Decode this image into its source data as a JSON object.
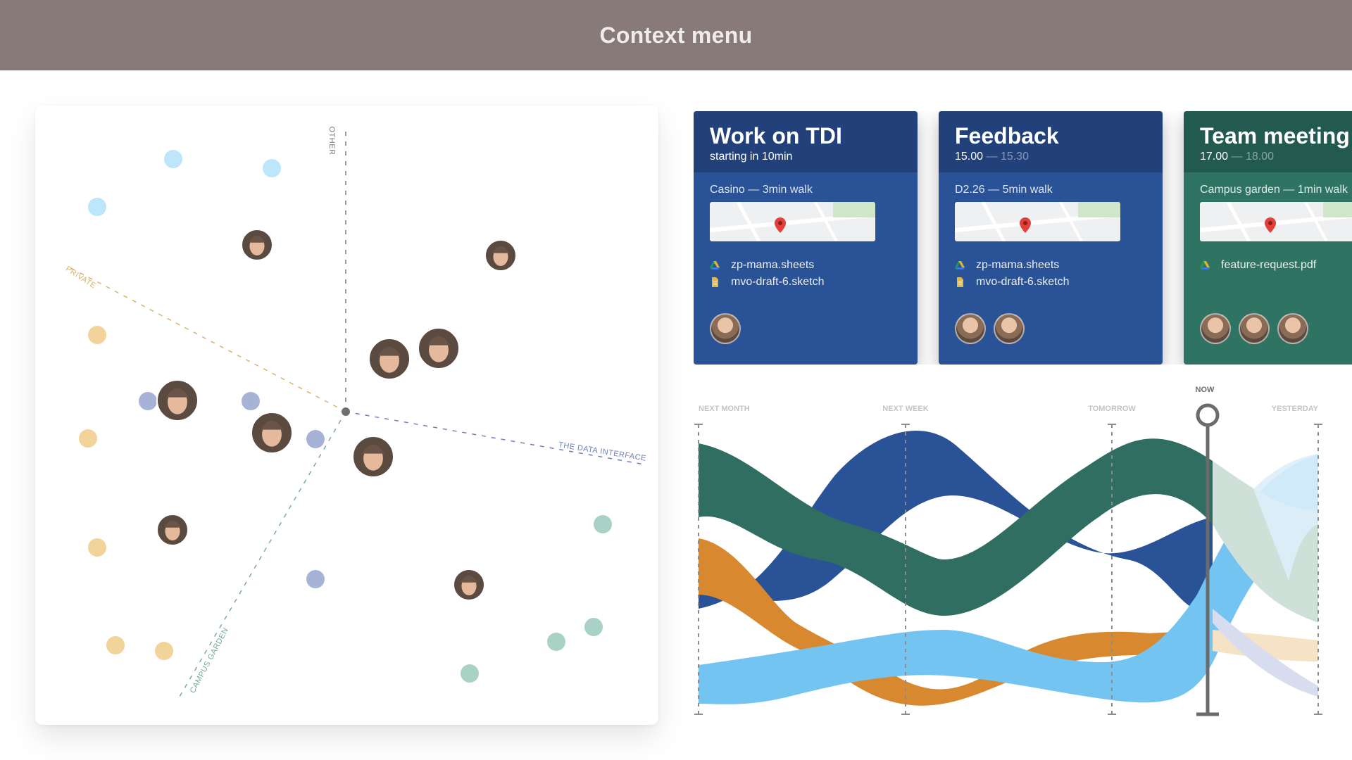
{
  "header": {
    "title": "Context menu"
  },
  "scatter": {
    "axes": [
      {
        "label": "OTHER",
        "color": "#7a7a7a"
      },
      {
        "label": "PRIVATE",
        "color": "#d9b36b"
      },
      {
        "label": "THE DATA INTERFACE",
        "color": "#6d7fb6"
      },
      {
        "label": "CAMPUS GARDEN",
        "color": "#79ab9c"
      }
    ],
    "category_colors": {
      "other": "#bde5fb",
      "private": "#f2d49b",
      "data_interface": "#a6b3d6",
      "campus_garden": "#a9d1c5"
    }
  },
  "cards": [
    {
      "title": "Work on TDI",
      "subtitle": "starting in 10min",
      "time_end": "",
      "location": "Casino — 3min walk",
      "files": [
        {
          "name": "zp-mama.sheets",
          "icon": "drive-icon"
        },
        {
          "name": "mvo-draft-6.sketch",
          "icon": "file-icon"
        }
      ],
      "people_count": 1,
      "head_color": "#22407a",
      "body_color": "#2a5297"
    },
    {
      "title": "Feedback",
      "subtitle": "15.00",
      "time_end": " — 15.30",
      "location": "D2.26 — 5min walk",
      "files": [
        {
          "name": "zp-mama.sheets",
          "icon": "drive-icon"
        },
        {
          "name": "mvo-draft-6.sketch",
          "icon": "file-icon"
        }
      ],
      "people_count": 2,
      "head_color": "#22407a",
      "body_color": "#2a5297"
    },
    {
      "title": "Team meeting",
      "subtitle": "17.00",
      "time_end": " — 18.00",
      "location": "Campus garden — 1min walk",
      "files": [
        {
          "name": "feature-request.pdf",
          "icon": "drive-icon"
        }
      ],
      "people_count": 3,
      "head_color": "#235a4f",
      "body_color": "#2f7463"
    }
  ],
  "timeline": {
    "ticks": [
      "NEXT MONTH",
      "NEXT WEEK",
      "TOMORROW",
      "NOW",
      "YESTERDAY"
    ],
    "now_label": "NOW",
    "stream_colors": {
      "work": "#2a5297",
      "campus": "#2f6e61",
      "private": "#d8882e",
      "other": "#74c4f2"
    }
  }
}
